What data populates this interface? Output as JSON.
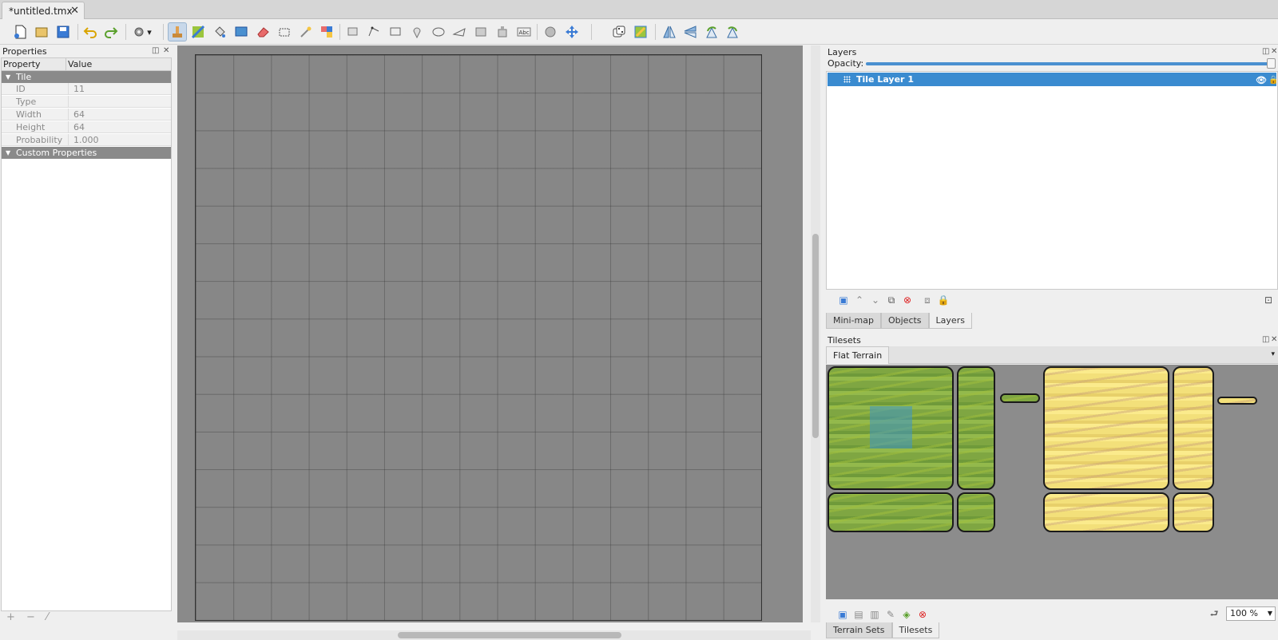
{
  "document_tab": {
    "title": "*untitled.tmx"
  },
  "properties": {
    "title": "Properties",
    "columns": [
      "Property",
      "Value"
    ],
    "group_tile": "Tile",
    "rows": [
      {
        "key": "ID",
        "value": "11"
      },
      {
        "key": "Type",
        "value": ""
      },
      {
        "key": "Width",
        "value": "64"
      },
      {
        "key": "Height",
        "value": "64"
      },
      {
        "key": "Probability",
        "value": "1.000"
      }
    ],
    "group_custom": "Custom Properties"
  },
  "layers": {
    "title": "Layers",
    "opacity_label": "Opacity:",
    "opacity": 1.0,
    "items": [
      {
        "name": "Tile Layer 1",
        "visible": true
      }
    ]
  },
  "dock_tabs": [
    {
      "label": "Mini-map",
      "selected": false
    },
    {
      "label": "Objects",
      "selected": false
    },
    {
      "label": "Layers",
      "selected": true
    }
  ],
  "tilesets": {
    "title": "Tilesets",
    "active_tab": "Flat Terrain",
    "zoom": "100 %"
  },
  "bottom_tabs": [
    {
      "label": "Terrain Sets",
      "selected": false
    },
    {
      "label": "Tilesets",
      "selected": true
    }
  ],
  "colors": {
    "accent": "#3a8bd0",
    "canvas": "#8a8a8a"
  },
  "toolbar_icons": [
    "new-icon",
    "open-icon",
    "save-icon",
    "undo-icon",
    "redo-icon",
    "commands-icon",
    "stamp-brush-icon",
    "terrain-brush-icon",
    "bucket-fill-icon",
    "shape-fill-icon",
    "eraser-icon",
    "rectangular-select-icon",
    "magic-wand-icon",
    "select-same-tile-icon",
    "select-objects-icon",
    "edit-polygons-icon",
    "insert-rectangle-icon",
    "insert-point-icon",
    "insert-ellipse-icon",
    "insert-polygon-icon",
    "insert-tile-icon",
    "insert-template-icon",
    "insert-text-icon",
    "world-tool-icon",
    "move-icon",
    "random-mode-icon",
    "wangfill-mode-icon",
    "flip-horizontal-icon",
    "flip-vertical-icon",
    "rotate-left-icon",
    "rotate-right-icon"
  ]
}
